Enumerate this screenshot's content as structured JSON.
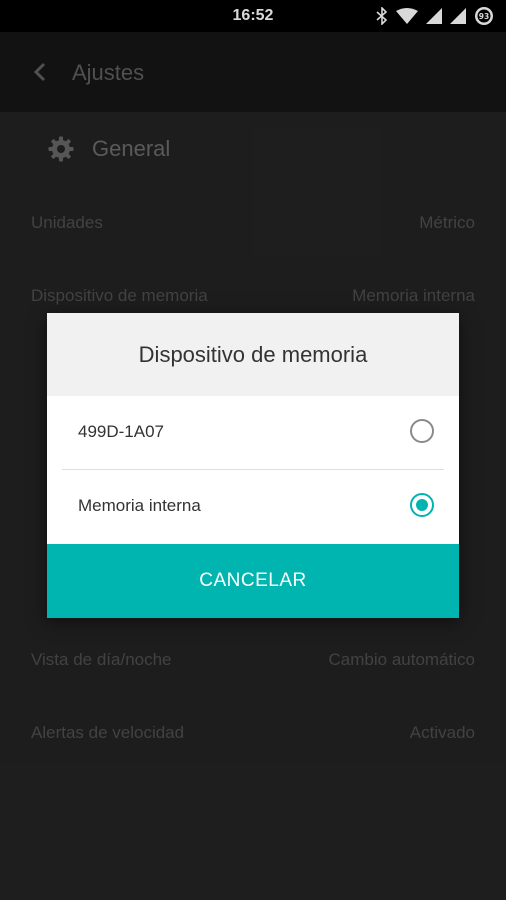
{
  "status_bar": {
    "time": "16:52",
    "battery_level": "93",
    "icons": [
      "bluetooth-icon",
      "wifi-icon",
      "signal-icon",
      "signal-icon",
      "battery-icon"
    ]
  },
  "app_bar": {
    "title": "Ajustes",
    "back_icon": "chevron-left-icon"
  },
  "settings": {
    "section": {
      "title": "General",
      "icon": "gear-icon"
    },
    "rows": [
      {
        "label": "Unidades",
        "value": "Métrico"
      },
      {
        "label": "Dispositivo de memoria",
        "value": "Memoria interna"
      },
      {
        "label": "Vista de día/noche",
        "value": "Cambio automático"
      },
      {
        "label": "Alertas de velocidad",
        "value": "Activado"
      }
    ]
  },
  "dialog": {
    "title": "Dispositivo de memoria",
    "options": [
      {
        "label": "499D-1A07",
        "selected": false
      },
      {
        "label": "Memoria interna",
        "selected": true
      }
    ],
    "cancel_label": "CANCELAR"
  },
  "colors": {
    "accent": "#00b5b0",
    "status_bar_bg": "#000000",
    "app_bar_bg": "#161616",
    "background": "#232323"
  }
}
